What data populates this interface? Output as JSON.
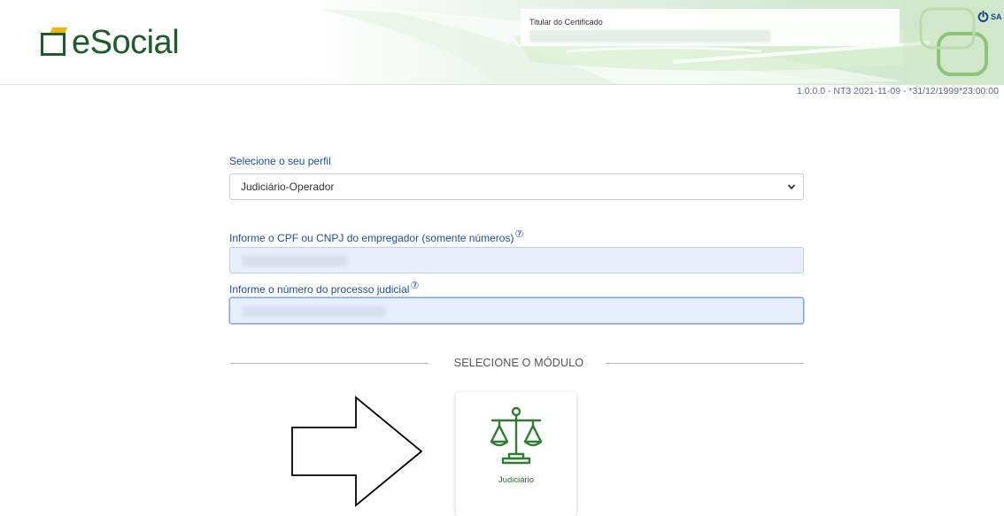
{
  "header": {
    "logo_text": "eSocial",
    "certificate_label": "Titular do Certificado",
    "logout_label": "SA"
  },
  "version": "1.0.0.0 - NT3 2021-11-09 - *31/12/1999*23:00:00",
  "form": {
    "profile_label": "Selecione o seu perfil",
    "profile_value": "Judiciário-Operador",
    "cpf_label": "Informe o CPF ou CNPJ do empregador (somente números)",
    "process_label": "Informe o número do processo judicial",
    "help_glyph": "⑦"
  },
  "module_section": {
    "heading": "SELECIONE O MÓDULO",
    "modules": [
      {
        "label": "Judiciário",
        "icon": "scale-icon"
      }
    ]
  },
  "colors": {
    "brand_green": "#1d5c28",
    "label_blue": "#1e4fa0",
    "input_fill": "#e8effc"
  }
}
